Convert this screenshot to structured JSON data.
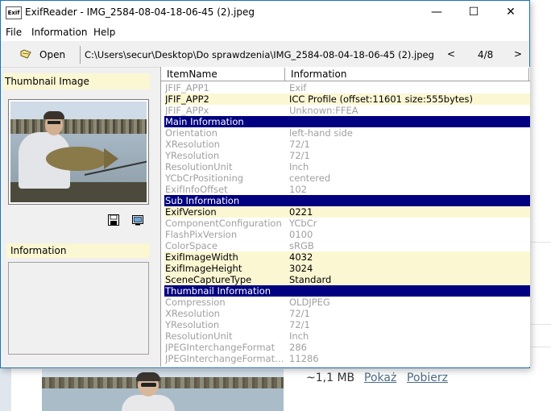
{
  "background": {
    "file_size": "~1,1 MB",
    "show_link": "Pokaż",
    "download_link": "Pobierz"
  },
  "window": {
    "app_icon_label": "Exif",
    "title": "ExifReader - IMG_2584-08-04-18-06-45 (2).jpeg",
    "minimize": "—",
    "maximize": "☐",
    "close": "✕"
  },
  "menu": [
    "File",
    "Information",
    "Help"
  ],
  "toolbar": {
    "open_label": "Open",
    "path": "C:\\Users\\secur\\Desktop\\Do sprawdzenia\\IMG_2584-08-04-18-06-45 (2).jpeg",
    "prev": "<",
    "counter": "4/8",
    "next": ">"
  },
  "left_panel": {
    "thumbnail_header": "Thumbnail Image",
    "info_header": "Information"
  },
  "table": {
    "headers": [
      "ItemName",
      "Information"
    ],
    "rows": [
      {
        "style": "gray",
        "name": "JFIF_APP1",
        "value": "Exif"
      },
      {
        "style": "yellow",
        "name": "JFIF_APP2",
        "value": "ICC Profile (offset:11601 size:555bytes)"
      },
      {
        "style": "gray",
        "name": "JFIF_APPx",
        "value": "Unknown:FFEA"
      },
      {
        "style": "section",
        "name": "Main Information",
        "value": ""
      },
      {
        "style": "gray",
        "name": "Orientation",
        "value": "left-hand side"
      },
      {
        "style": "gray",
        "name": "XResolution",
        "value": "72/1"
      },
      {
        "style": "gray",
        "name": "YResolution",
        "value": "72/1"
      },
      {
        "style": "gray",
        "name": "ResolutionUnit",
        "value": "Inch"
      },
      {
        "style": "gray",
        "name": "YCbCrPositioning",
        "value": "centered"
      },
      {
        "style": "gray",
        "name": "ExifInfoOffset",
        "value": "102"
      },
      {
        "style": "section",
        "name": "Sub Information",
        "value": ""
      },
      {
        "style": "yellow",
        "name": "ExifVersion",
        "value": "0221"
      },
      {
        "style": "gray",
        "name": "ComponentConfiguration",
        "value": "YCbCr"
      },
      {
        "style": "gray",
        "name": "FlashPixVersion",
        "value": "0100"
      },
      {
        "style": "gray",
        "name": "ColorSpace",
        "value": "sRGB"
      },
      {
        "style": "yellow",
        "name": "ExifImageWidth",
        "value": "4032"
      },
      {
        "style": "yellow",
        "name": "ExifImageHeight",
        "value": "3024"
      },
      {
        "style": "yellow",
        "name": "SceneCaptureType",
        "value": "Standard"
      },
      {
        "style": "section",
        "name": "Thumbnail Information",
        "value": ""
      },
      {
        "style": "gray",
        "name": "Compression",
        "value": "OLDJPEG"
      },
      {
        "style": "gray",
        "name": "XResolution",
        "value": "72/1"
      },
      {
        "style": "gray",
        "name": "YResolution",
        "value": "72/1"
      },
      {
        "style": "gray",
        "name": "ResolutionUnit",
        "value": "Inch"
      },
      {
        "style": "gray",
        "name": "JPEGInterchangeFormat",
        "value": "286"
      },
      {
        "style": "gray",
        "name": "JPEGInterchangeFormatLen...",
        "value": "11286"
      }
    ]
  },
  "colors": {
    "highlight_row": "#fbf7d3",
    "section_row": "#000080",
    "muted_text": "#a0a0a0",
    "window_border": "#1a73b8"
  }
}
